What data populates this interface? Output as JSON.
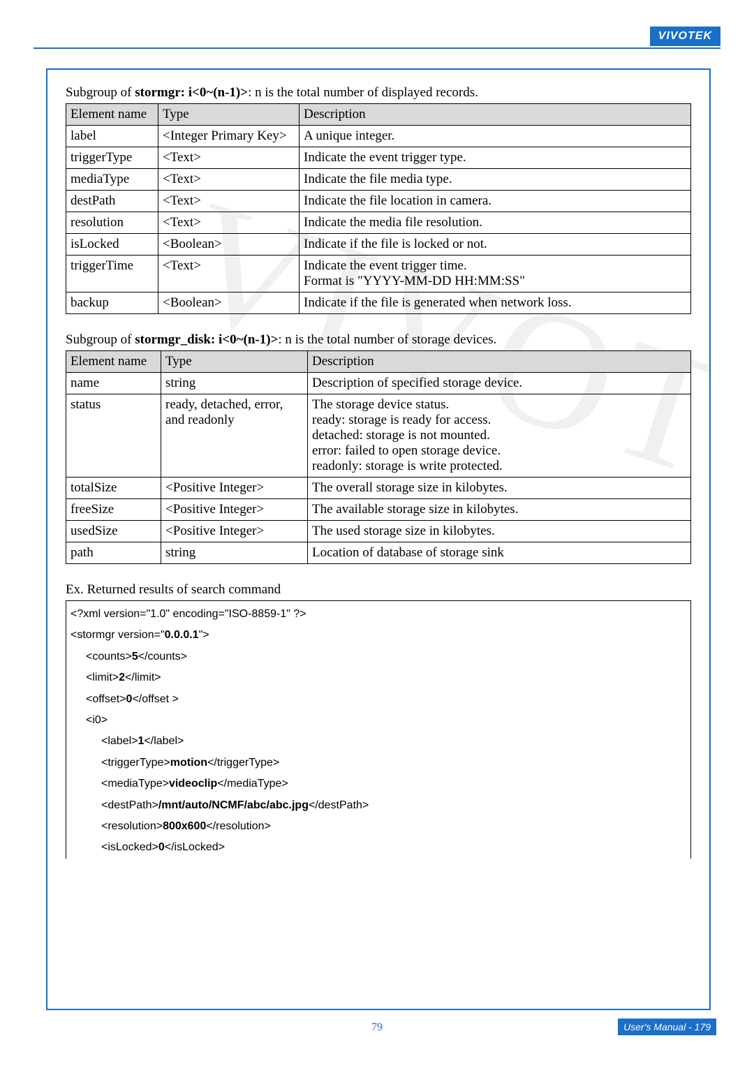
{
  "brand": "VIVOTEK",
  "table1_caption_prefix": "Subgroup of ",
  "table1_caption_bold": "stormgr: i<0~(n-1)>",
  "table1_caption_suffix": ": n is the total number of displayed records.",
  "headers": {
    "name": "Element name",
    "type": "Type",
    "desc": "Description"
  },
  "table1": [
    {
      "name": "label",
      "type": "<Integer Primary Key>",
      "desc": "A unique integer."
    },
    {
      "name": "triggerType",
      "type": "<Text>",
      "desc": "Indicate the event trigger type."
    },
    {
      "name": "mediaType",
      "type": "<Text>",
      "desc": "Indicate the file media type."
    },
    {
      "name": "destPath",
      "type": "<Text>",
      "desc": "Indicate the file location in camera."
    },
    {
      "name": "resolution",
      "type": "<Text>",
      "desc": "Indicate the media file resolution."
    },
    {
      "name": "isLocked",
      "type": "<Boolean>",
      "desc": "Indicate if the file is locked or not."
    },
    {
      "name": "triggerTime",
      "type": "<Text>",
      "desc": "Indicate the event trigger time.\nFormat is \"YYYY-MM-DD HH:MM:SS\""
    },
    {
      "name": "backup",
      "type": "<Boolean>",
      "desc": "Indicate if the file is generated when network loss."
    }
  ],
  "table2_caption_prefix": "Subgroup of ",
  "table2_caption_bold": "stormgr_disk: i<0~(n-1)>",
  "table2_caption_suffix": ": n is the total number of storage devices.",
  "table2": [
    {
      "name": "name",
      "type": "string",
      "desc": "Description of specified storage device."
    },
    {
      "name": "status",
      "type": "ready, detached, error, and readonly",
      "desc": "The storage device status.\nready: storage is ready for access.\ndetached: storage is not mounted.\nerror: failed to open storage device.\nreadonly: storage is write protected."
    },
    {
      "name": "totalSize",
      "type": "<Positive Integer>",
      "desc": "The overall storage size in kilobytes."
    },
    {
      "name": "freeSize",
      "type": "<Positive Integer>",
      "desc": "The available storage size in kilobytes."
    },
    {
      "name": "usedSize",
      "type": "<Positive Integer>",
      "desc": "The used storage size in kilobytes."
    },
    {
      "name": "path",
      "type": "string",
      "desc": "Location of database of storage sink"
    }
  ],
  "example_caption": "Ex. Returned results of search command",
  "xml": {
    "decl": "<?xml version=\"1.0\" encoding=\"ISO-8859-1\" ?>",
    "root_open_a": "<stormgr version=\"",
    "root_version": "0.0.0.1",
    "root_open_b": "\">",
    "counts_open": "<counts>",
    "counts_val": "5",
    "counts_close": "</counts>",
    "limit_open": "<limit>",
    "limit_val": "2",
    "limit_close": "</limit>",
    "offset_open": "<offset>",
    "offset_val": "0",
    "offset_close": "</offset >",
    "i0_open": "<i0>",
    "label_open": "<label>",
    "label_val": "1",
    "label_close": "</label>",
    "trig_open": "<triggerType>",
    "trig_val": "motion",
    "trig_close": "</triggerType>",
    "media_open": "<mediaType>",
    "media_val": "videoclip",
    "media_close": "</mediaType>",
    "dest_open": "<destPath>",
    "dest_val": "/mnt/auto/NCMF/abc/abc.jpg",
    "dest_close": "</destPath>",
    "res_open": "<resolution>",
    "res_val": "800x600",
    "res_close": "</resolution>",
    "lock_open": "<isLocked>",
    "lock_val": "0",
    "lock_close": "</isLocked>"
  },
  "page_number": "79",
  "footer_right": "User's Manual - 179"
}
